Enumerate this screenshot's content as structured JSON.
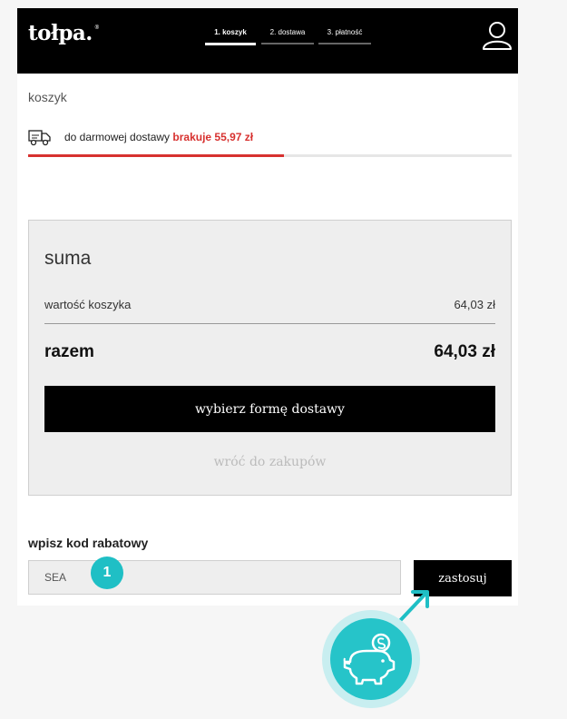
{
  "header": {
    "logo": "tołpa.",
    "logo_mark": "®",
    "steps": [
      {
        "label": "1. koszyk",
        "active": true
      },
      {
        "label": "2. dostawa",
        "active": false
      },
      {
        "label": "3. płatność",
        "active": false
      }
    ],
    "user_icon": "user-icon"
  },
  "page": {
    "breadcrumb": "koszyk"
  },
  "free_shipping": {
    "icon": "delivery-truck-icon",
    "text": "do darmowej dostawy",
    "missing": "brakuje 55,97 zł",
    "progress_fraction": 0.53,
    "accent": "#d7312f"
  },
  "summary": {
    "title": "suma",
    "cart_value_label": "wartość koszyka",
    "cart_value": "64,03 zł",
    "total_label": "razem",
    "total_value": "64,03 zł",
    "cta_label": "wybierz formę dostawy",
    "back_link": "wróć do zakupów"
  },
  "promo": {
    "label": "wpisz kod rabatowy",
    "input_value": "SEA",
    "apply_label": "zastosuj"
  },
  "annotation": {
    "marker_number": "1",
    "marker_color": "#1fbfc5",
    "badge_icon": "piggy-bank-coin-icon"
  }
}
